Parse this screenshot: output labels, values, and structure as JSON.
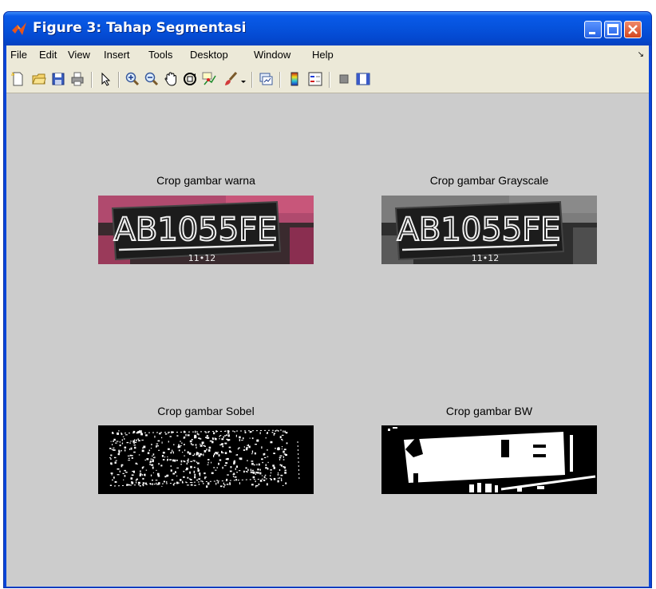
{
  "window": {
    "title": "Figure 3: Tahap Segmentasi"
  },
  "menu": {
    "items": [
      "File",
      "Edit",
      "View",
      "Insert",
      "Tools",
      "Desktop",
      "Window",
      "Help"
    ]
  },
  "toolbar": {
    "tools": [
      "new-figure-icon",
      "open-file-icon",
      "save-icon",
      "print-icon",
      "pointer-icon",
      "zoom-in-icon",
      "zoom-out-icon",
      "pan-icon",
      "rotate-3d-icon",
      "data-cursor-icon",
      "brush-icon",
      "link-plot-icon",
      "colorbar-icon",
      "legend-icon",
      "hide-plot-tools-icon",
      "show-plot-tools-icon"
    ]
  },
  "axes": [
    {
      "title": "Crop gambar warna",
      "image": "color-plate"
    },
    {
      "title": "Crop gambar Grayscale",
      "image": "grayscale-plate"
    },
    {
      "title": "Crop gambar Sobel",
      "image": "sobel-plate"
    },
    {
      "title": "Crop gambar BW",
      "image": "bw-plate"
    }
  ],
  "plate": {
    "number": "AB1055FE",
    "date": "11•12"
  },
  "colors": {
    "titlebar": "#0a5ae8",
    "menubar": "#ece9d8",
    "canvas": "#cccccc",
    "plate_bg": "#1c1c1c",
    "car_body": "#b04a6e"
  }
}
